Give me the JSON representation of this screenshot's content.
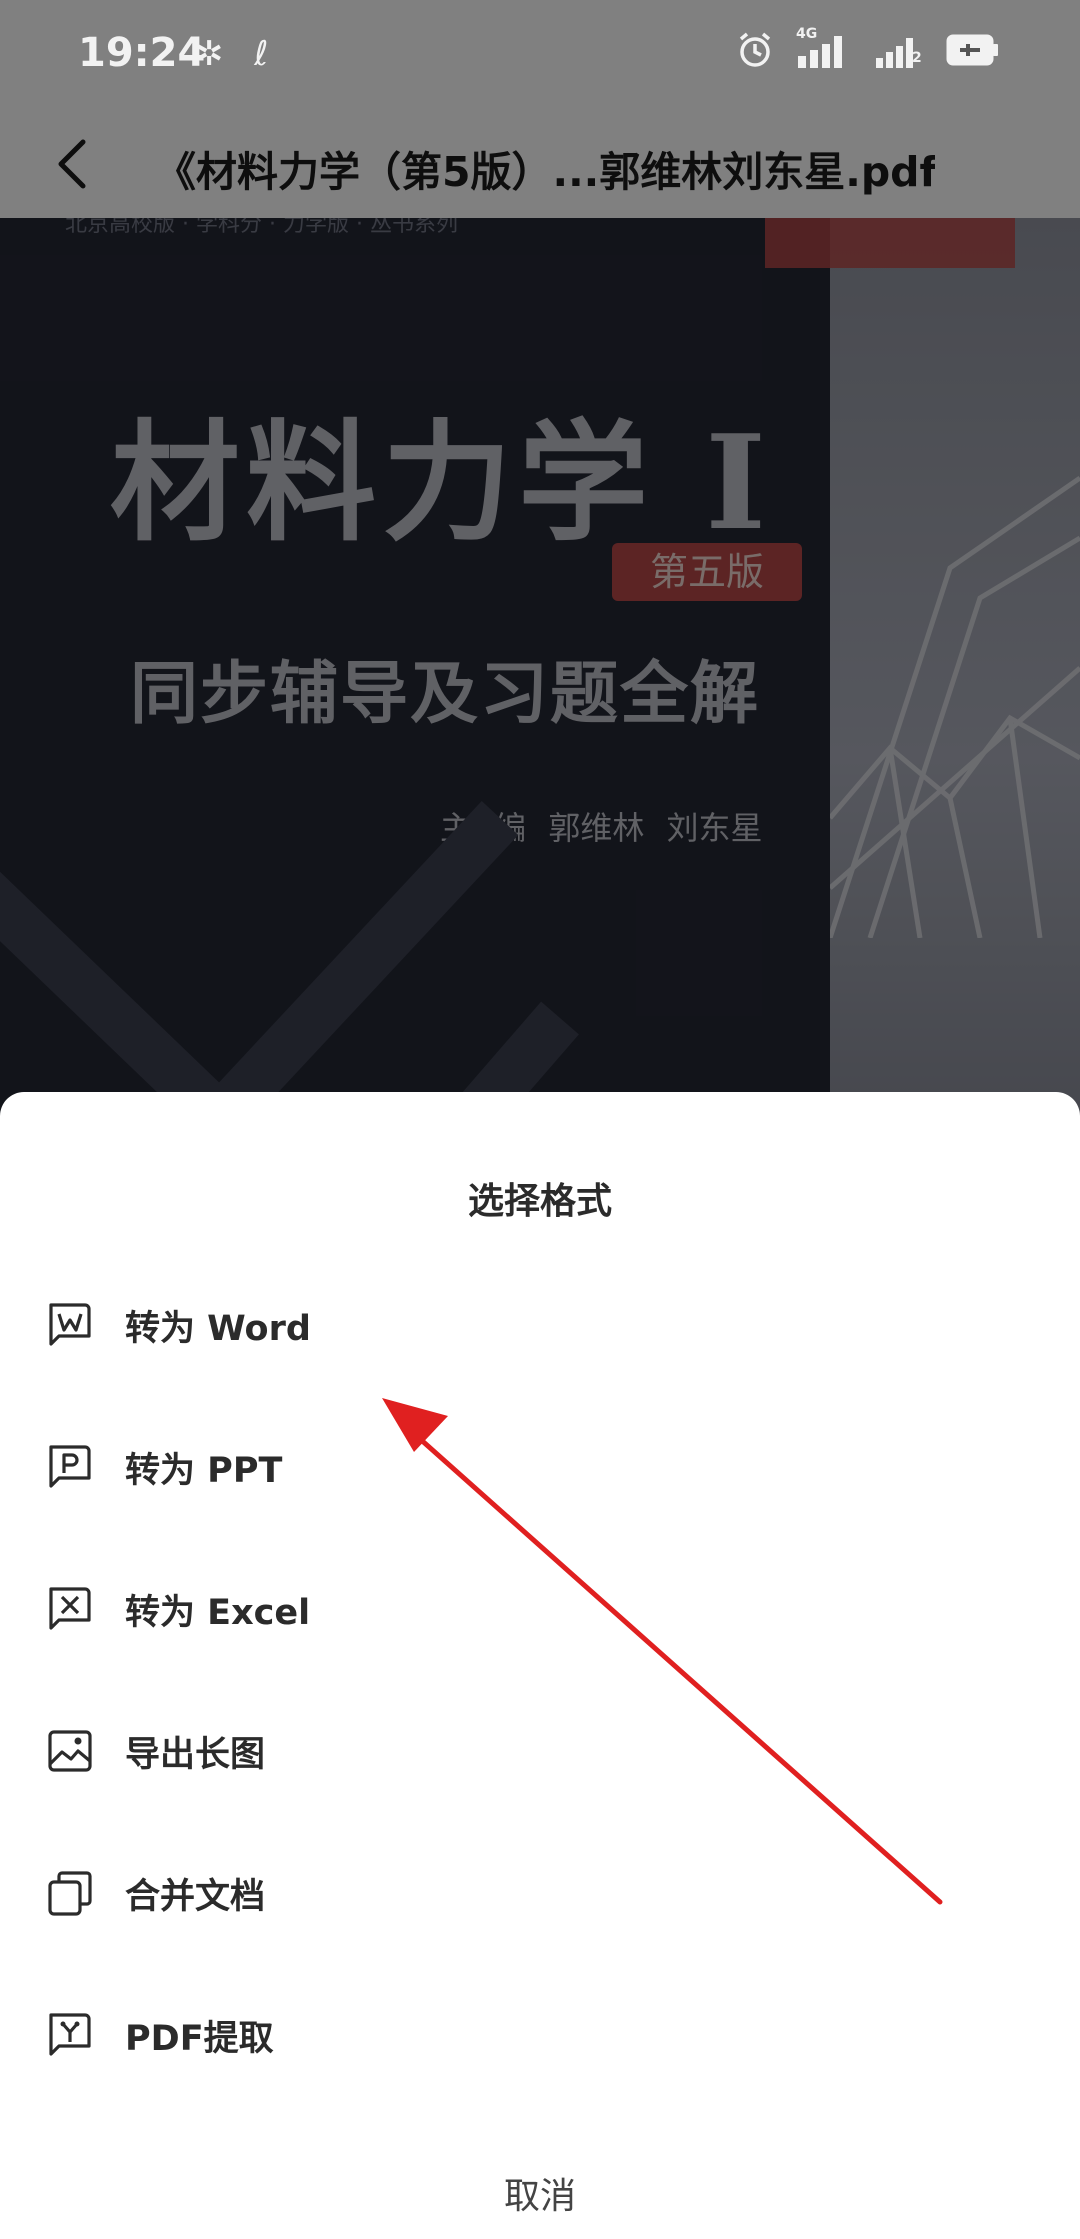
{
  "status_bar": {
    "time": "19:24",
    "network_label": "4G",
    "sim2_label": "2"
  },
  "header": {
    "title": "《材料力学（第5版）...郭维林刘东星.pdf"
  },
  "document": {
    "cover_top_text": "北京高校版 · 学科分 · 力学版 · 丛书系列",
    "cover_title": "材料力学 I",
    "edition_badge": "第五版",
    "cover_subtitle": "同步辅导及习题全解",
    "cover_authors": "主 编 郭维林 刘东星"
  },
  "sheet": {
    "title": "选择格式",
    "items": [
      {
        "label": "转为 Word",
        "icon": "word-doc-icon"
      },
      {
        "label": "转为 PPT",
        "icon": "ppt-doc-icon"
      },
      {
        "label": "转为 Excel",
        "icon": "excel-doc-icon"
      },
      {
        "label": "导出长图",
        "icon": "image-icon"
      },
      {
        "label": "合并文档",
        "icon": "merge-copy-icon"
      },
      {
        "label": "PDF提取",
        "icon": "extract-doc-icon"
      }
    ],
    "cancel_label": "取消"
  },
  "annotation": {
    "color": "#e02020"
  },
  "colors": {
    "sheet_bg": "#ffffff",
    "text": "#2b2b2b"
  }
}
